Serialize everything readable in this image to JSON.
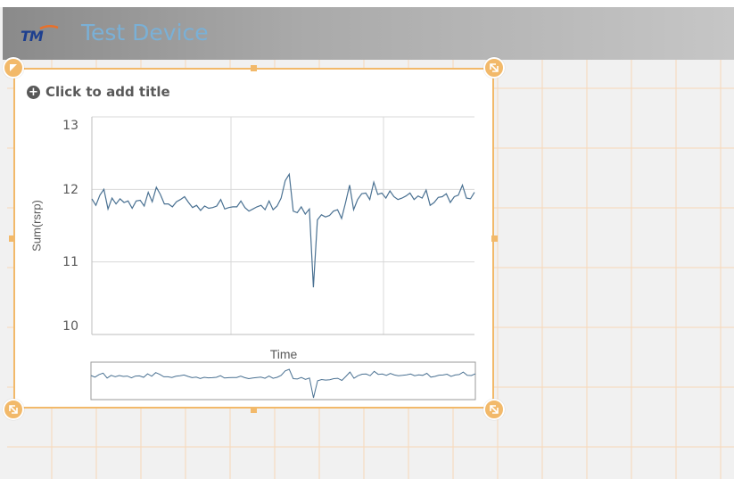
{
  "header": {
    "logo_text": "TM",
    "title": "Test Device"
  },
  "object": {
    "add_title_label": "Click to add title"
  },
  "colors": {
    "line": "#4a7192",
    "selection": "#f2b96a",
    "header_title": "#7ab0d6",
    "gridline": "#d8d8d8"
  },
  "chart_data": {
    "type": "line",
    "xlabel": "Time",
    "ylabel": "Sum(rsrp)",
    "ylim": [
      10,
      13
    ],
    "yticks": [
      "13",
      "12",
      "11",
      "10"
    ],
    "grid": true,
    "series": [
      {
        "values": [
          11.87,
          11.78,
          11.92,
          12.0,
          11.73,
          11.88,
          11.8,
          11.87,
          11.82,
          11.84,
          11.74,
          11.84,
          11.85,
          11.77,
          11.96,
          11.83,
          12.03,
          11.93,
          11.8,
          11.8,
          11.76,
          11.83,
          11.86,
          11.9,
          11.82,
          11.75,
          11.78,
          11.71,
          11.77,
          11.74,
          11.75,
          11.77,
          11.86,
          11.73,
          11.75,
          11.76,
          11.76,
          11.84,
          11.75,
          11.7,
          11.73,
          11.76,
          11.78,
          11.72,
          11.84,
          11.72,
          11.77,
          11.88,
          12.12,
          12.21,
          11.7,
          11.68,
          11.76,
          11.66,
          11.73,
          10.65,
          11.58,
          11.65,
          11.62,
          11.64,
          11.7,
          11.72,
          11.6,
          11.82,
          12.06,
          11.72,
          11.86,
          11.94,
          11.95,
          11.86,
          12.1,
          11.93,
          11.95,
          11.88,
          11.98,
          11.9,
          11.86,
          11.88,
          11.91,
          11.95,
          11.86,
          11.91,
          11.88,
          11.99,
          11.78,
          11.82,
          11.89,
          11.9,
          11.94,
          11.82,
          11.9,
          11.92,
          12.06,
          11.88,
          11.87,
          11.96
        ]
      }
    ]
  }
}
